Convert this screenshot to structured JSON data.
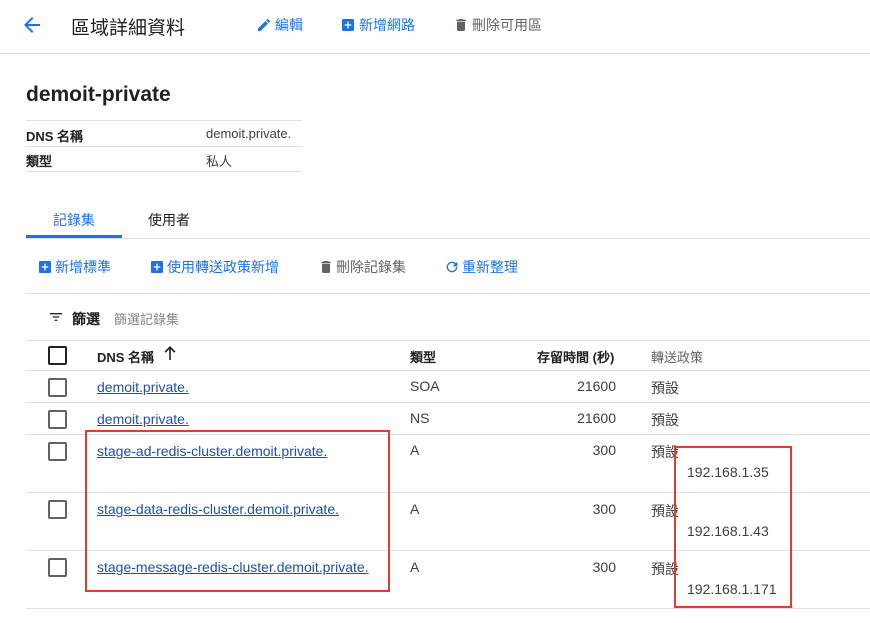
{
  "header": {
    "title": "區域詳細資料",
    "edit_label": "編輯",
    "add_network_label": "新增網路",
    "delete_label": "刪除可用區"
  },
  "zone": {
    "name": "demoit-private",
    "dns_name_label": "DNS 名稱",
    "dns_name_value": "demoit.private.",
    "type_label": "類型",
    "type_value": "私人"
  },
  "tabs": [
    {
      "label": "記錄集",
      "active": true
    },
    {
      "label": "使用者",
      "active": false
    }
  ],
  "record_toolbar": {
    "add_standard": "新增標準",
    "add_with_policy": "使用轉送政策新增",
    "delete_records": "刪除記錄集",
    "refresh": "重新整理"
  },
  "filter": {
    "label": "篩選",
    "placeholder": "篩選記錄集"
  },
  "table": {
    "headers": {
      "dns_name": "DNS 名稱",
      "type": "類型",
      "ttl": "存留時間 (秒)",
      "policy": "轉送政策"
    },
    "rows": [
      {
        "dns_name": "demoit.private.",
        "type": "SOA",
        "ttl": "21600",
        "policy": "預設",
        "data": ""
      },
      {
        "dns_name": "demoit.private.",
        "type": "NS",
        "ttl": "21600",
        "policy": "預設",
        "data": ""
      },
      {
        "dns_name": "stage-ad-redis-cluster.demoit.private.",
        "type": "A",
        "ttl": "300",
        "policy": "預設",
        "data": "192.168.1.35"
      },
      {
        "dns_name": "stage-data-redis-cluster.demoit.private.",
        "type": "A",
        "ttl": "300",
        "policy": "預設",
        "data": "192.168.1.43"
      },
      {
        "dns_name": "stage-message-redis-cluster.demoit.private.",
        "type": "A",
        "ttl": "300",
        "policy": "預設",
        "data": "192.168.1.171"
      }
    ]
  },
  "colors": {
    "accent": "#1a73e8",
    "annotation": "#e53b2f"
  }
}
